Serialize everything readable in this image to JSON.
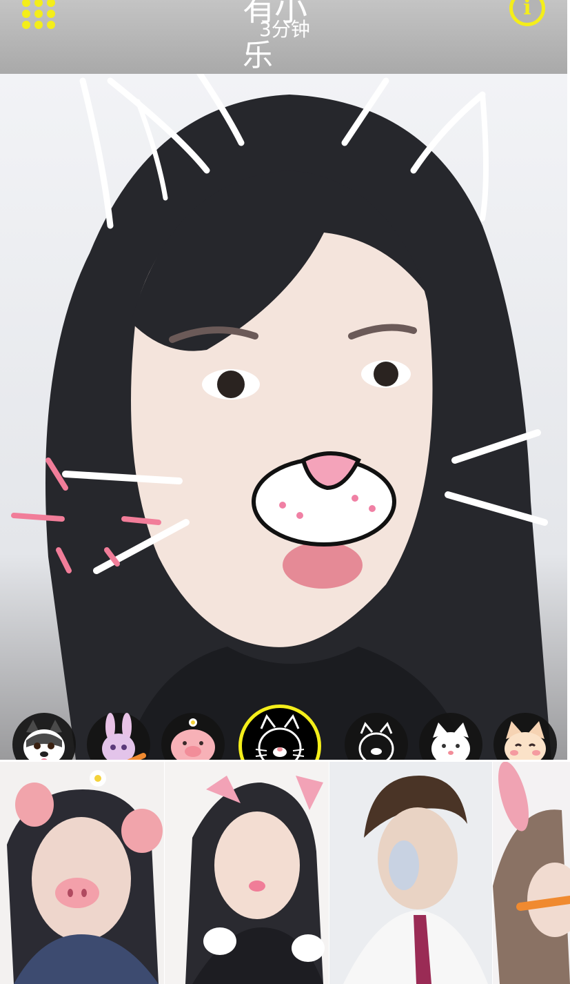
{
  "app": {
    "brand_line1": "有小",
    "brand_line2": "3分钟",
    "brand_line3": "乐"
  },
  "icons": {
    "menu": "grid-dots-icon",
    "info": "info-icon",
    "download": "download-arrow-icon"
  },
  "colors": {
    "accent": "#f4ee1a",
    "topbar": "#b4b4b4",
    "filter_bg": "#141414"
  },
  "filters": [
    {
      "name": "husky-dog",
      "state": "ready"
    },
    {
      "name": "bunny-carrot",
      "state": "ready"
    },
    {
      "name": "pig-daisy",
      "state": "ready"
    },
    {
      "name": "white-cat-outline",
      "state": "selected"
    },
    {
      "name": "cat-outline-small",
      "state": "download"
    },
    {
      "name": "white-kitten",
      "state": "download"
    },
    {
      "name": "fox-blush",
      "state": "download"
    }
  ],
  "gallery": [
    {
      "name": "pig-ears-sample"
    },
    {
      "name": "cat-ears-sample"
    },
    {
      "name": "rainbow-face-sample"
    },
    {
      "name": "bunny-ear-sample"
    }
  ]
}
